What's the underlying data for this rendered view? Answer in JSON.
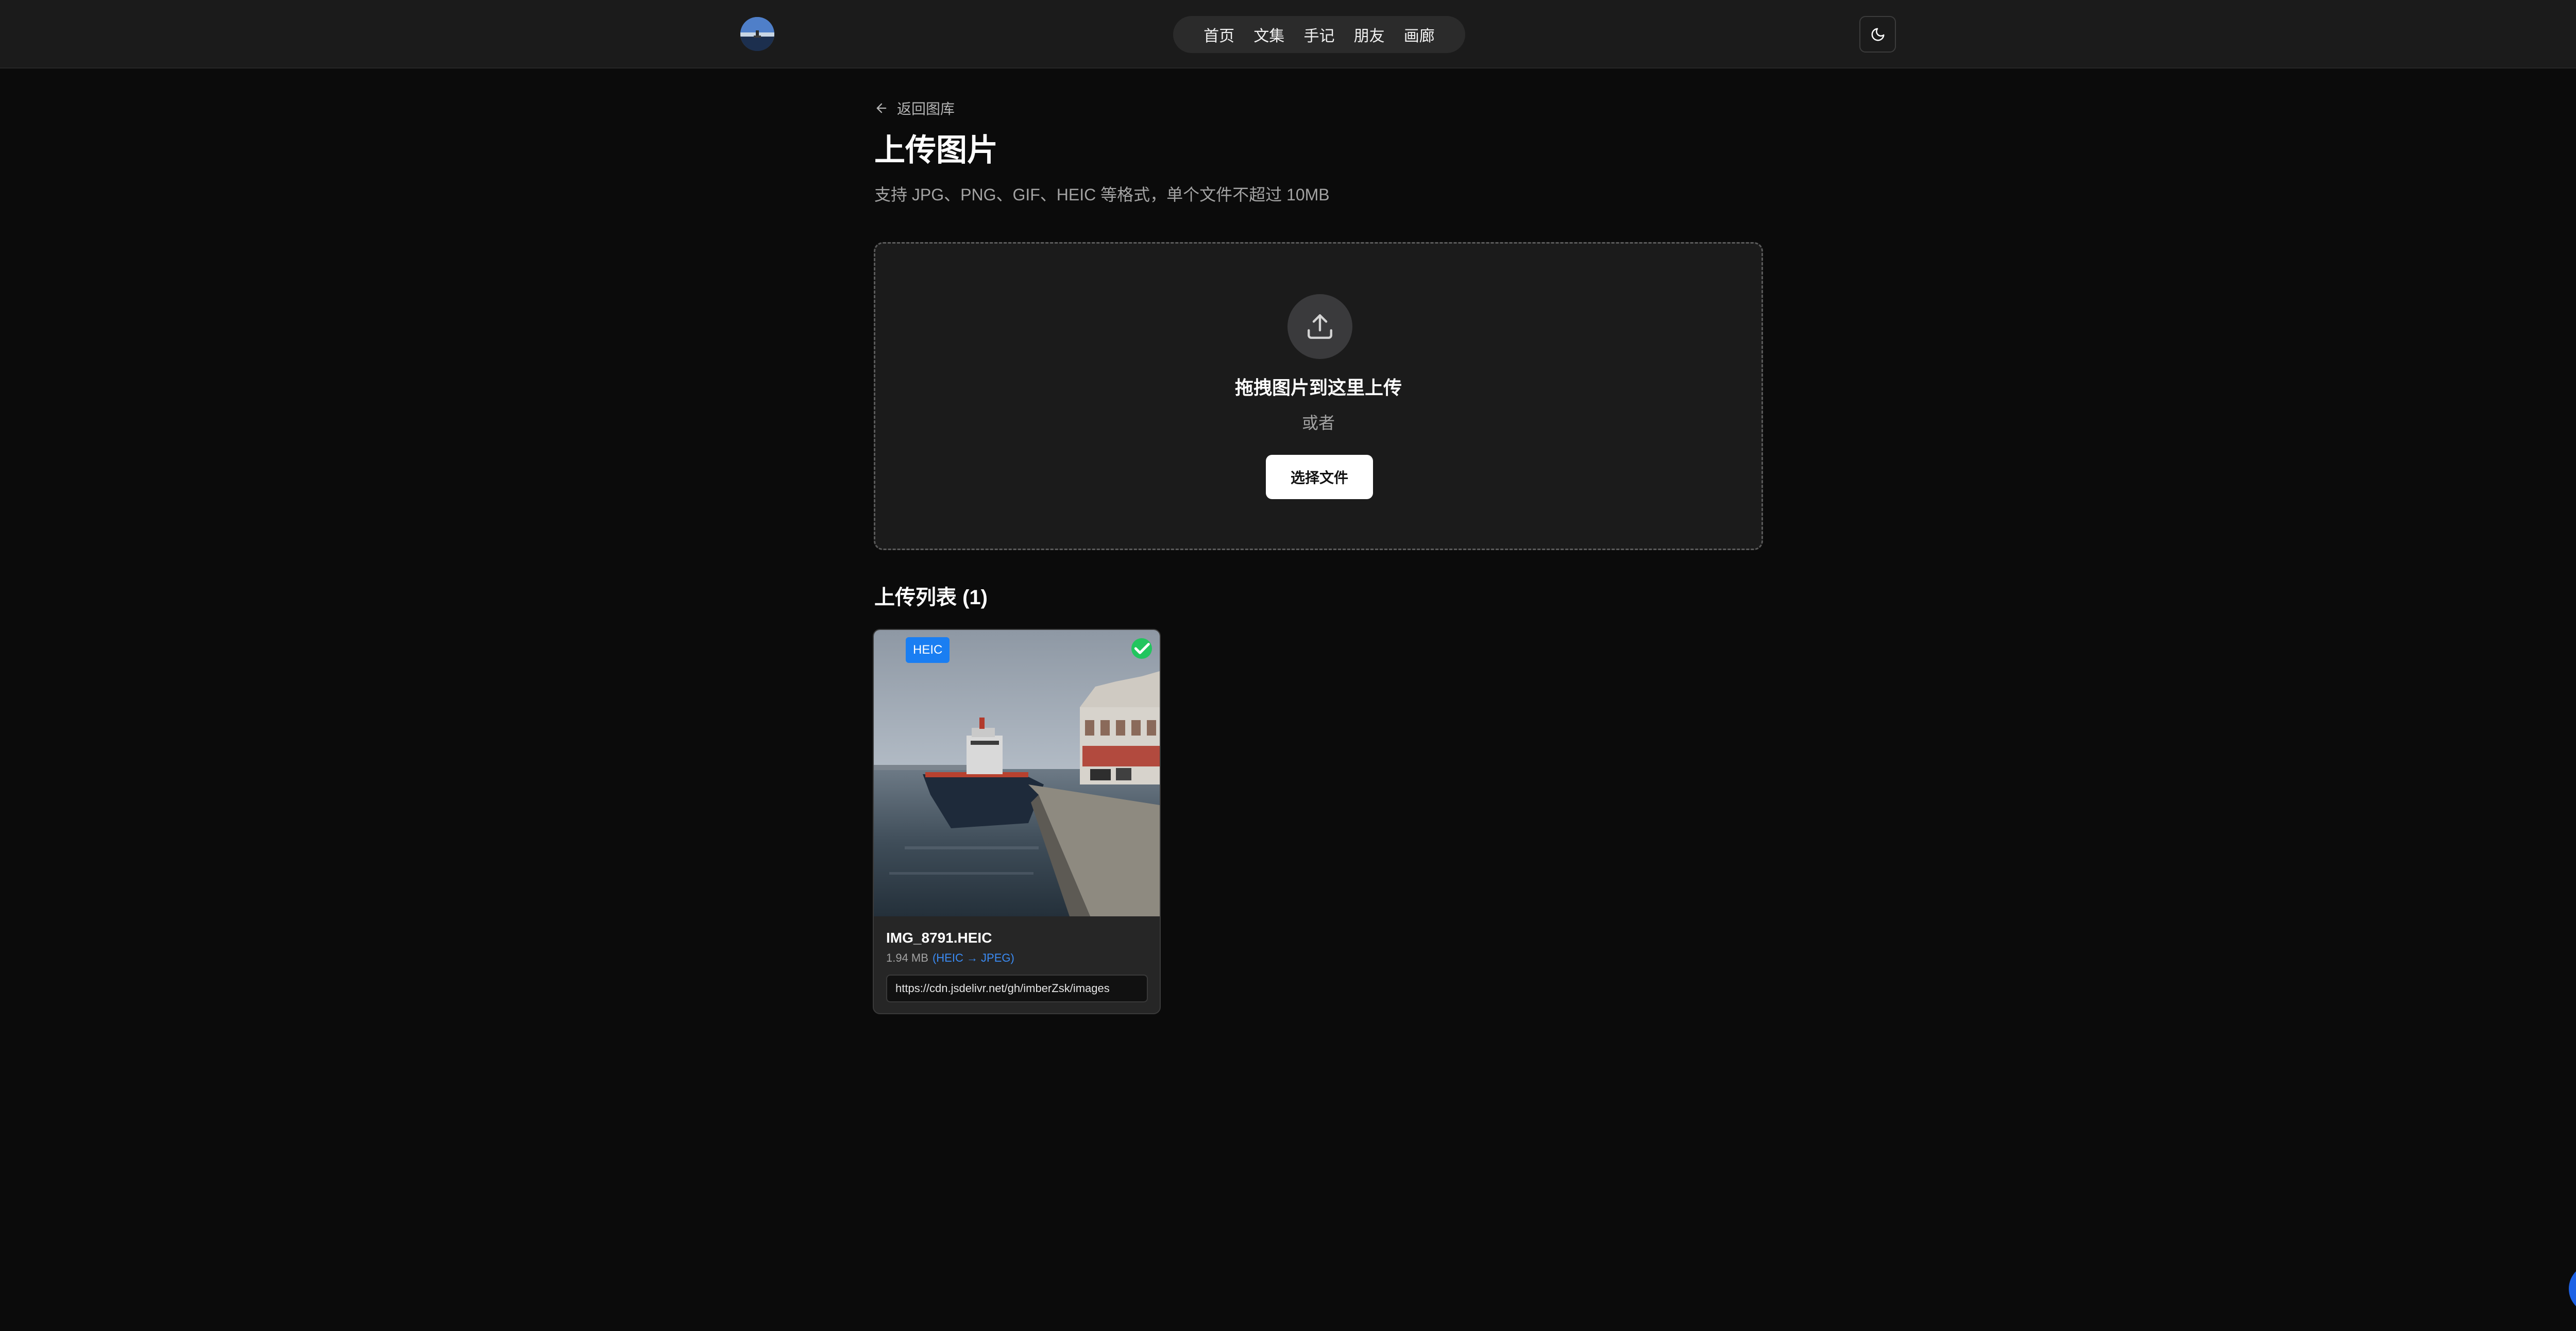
{
  "header": {
    "avatar_icon": "avatar-icon",
    "nav": [
      {
        "label": "首页"
      },
      {
        "label": "文集"
      },
      {
        "label": "手记"
      },
      {
        "label": "朋友"
      },
      {
        "label": "画廊"
      }
    ],
    "theme_icon": "moon-icon"
  },
  "main": {
    "back_label": "返回图库",
    "title": "上传图片",
    "subtitle": "支持 JPG、PNG、GIF、HEIC 等格式，单个文件不超过 10MB",
    "dropzone": {
      "icon": "upload-icon",
      "title": "拖拽图片到这里上传",
      "or_text": "或者",
      "select_label": "选择文件"
    },
    "upload_list": {
      "title": "上传列表 (1)",
      "items": [
        {
          "format_badge": "HEIC",
          "status": "success",
          "status_color": "#22c55e",
          "name": "IMG_8791.HEIC",
          "size": "1.94 MB",
          "conversion": "(HEIC → JPEG)",
          "url": "https://cdn.jsdelivr.net/gh/imberZsk/images"
        }
      ]
    }
  },
  "chat": {
    "icon": "chat-bubble-icon"
  },
  "colors": {
    "accent_blue": "#1a7ef2",
    "background": "#0b0b0b",
    "header": "#1b1b1b"
  }
}
